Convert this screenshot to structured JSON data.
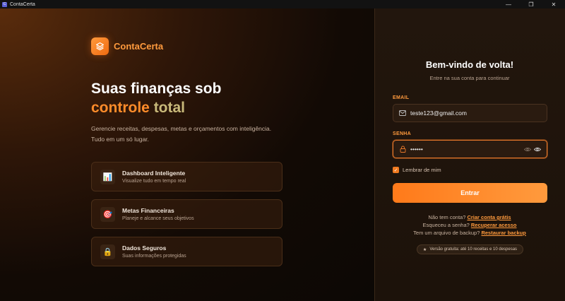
{
  "window": {
    "title": "ContaCerta",
    "controls": {
      "minimize": "—",
      "maximize": "❐",
      "close": "✕"
    }
  },
  "brand": {
    "name": "ContaCerta"
  },
  "hero": {
    "line1": "Suas finanças sob",
    "word_controle": "controle",
    "word_total": "total",
    "subtext": "Gerencie receitas, despesas, metas e orçamentos com inteligência. Tudo em um só lugar."
  },
  "features": [
    {
      "icon": "📊",
      "title": "Dashboard Inteligente",
      "description": "Visualize tudo em tempo real"
    },
    {
      "icon": "🎯",
      "title": "Metas Financeiras",
      "description": "Planeje e alcance seus objetivos"
    },
    {
      "icon": "🔒",
      "title": "Dados Seguros",
      "description": "Suas informações protegidas"
    }
  ],
  "login": {
    "title": "Bem-vindo de volta!",
    "subtitle": "Entre na sua conta para continuar",
    "email_label": "EMAIL",
    "email_value": "teste123@gmail.com",
    "password_label": "SENHA",
    "password_value": "••••••",
    "remember_label": "Lembrar de mim",
    "remember_checked": true,
    "submit_label": "Entrar",
    "signup_prefix": "Não tem conta?",
    "signup_link": "Criar conta grátis",
    "forgot_prefix": "Esqueceu a senha?",
    "forgot_link": "Recuperar acesso",
    "backup_prefix": "Tem um arquivo de backup?",
    "backup_link": "Restaurar backup",
    "badge_icon": "★",
    "badge_text": "Versão gratuita: até 10 receitas e 10 despesas"
  },
  "colors": {
    "accent": "#ff8c2a",
    "accent_light": "#ff9a3d",
    "gold": "#c9b97a"
  }
}
